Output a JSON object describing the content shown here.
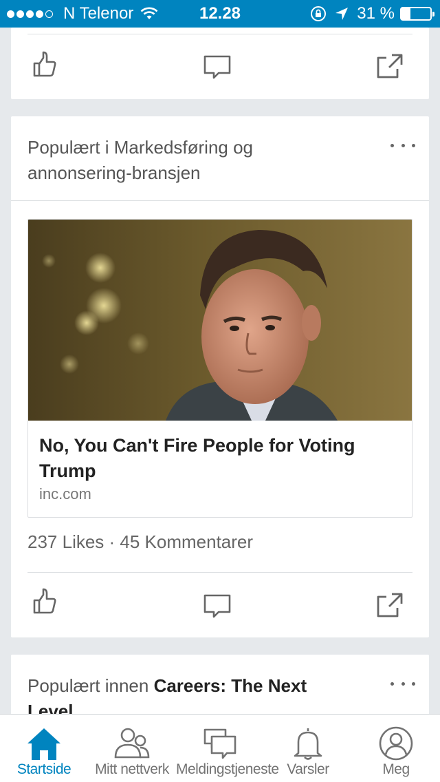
{
  "status_bar": {
    "carrier": "N Telenor",
    "time": "12.28",
    "battery_percent_label": "31 %",
    "battery_level": 0.31,
    "signal_bars_filled": 4,
    "signal_bars_total": 5
  },
  "top_card": {
    "actions": [
      "like-icon",
      "comment-icon",
      "share-icon"
    ]
  },
  "main_card": {
    "header_prefix": "Populært i Markedsføring og annonsering-bransjen",
    "article": {
      "title": "No, You Can't Fire People for Voting Trump",
      "source": "inc.com"
    },
    "social_counts": "237 Likes · 45 Kommentarer"
  },
  "bottom_card": {
    "header_prefix": "Populært innen ",
    "header_bold": "Careers: The Next Level"
  },
  "tab_bar": {
    "tabs": [
      {
        "label": "Startside",
        "icon": "home-icon",
        "active": true
      },
      {
        "label": "Mitt nettverk",
        "icon": "network-icon",
        "active": false
      },
      {
        "label": "Meldingstjeneste",
        "icon": "messaging-icon",
        "active": false
      },
      {
        "label": "Varsler",
        "icon": "bell-icon",
        "active": false
      },
      {
        "label": "Meg",
        "icon": "profile-icon",
        "active": false
      }
    ]
  },
  "colors": {
    "brand_blue": "#0084bf",
    "background": "#e6e9ec",
    "icon_gray": "#666666"
  }
}
